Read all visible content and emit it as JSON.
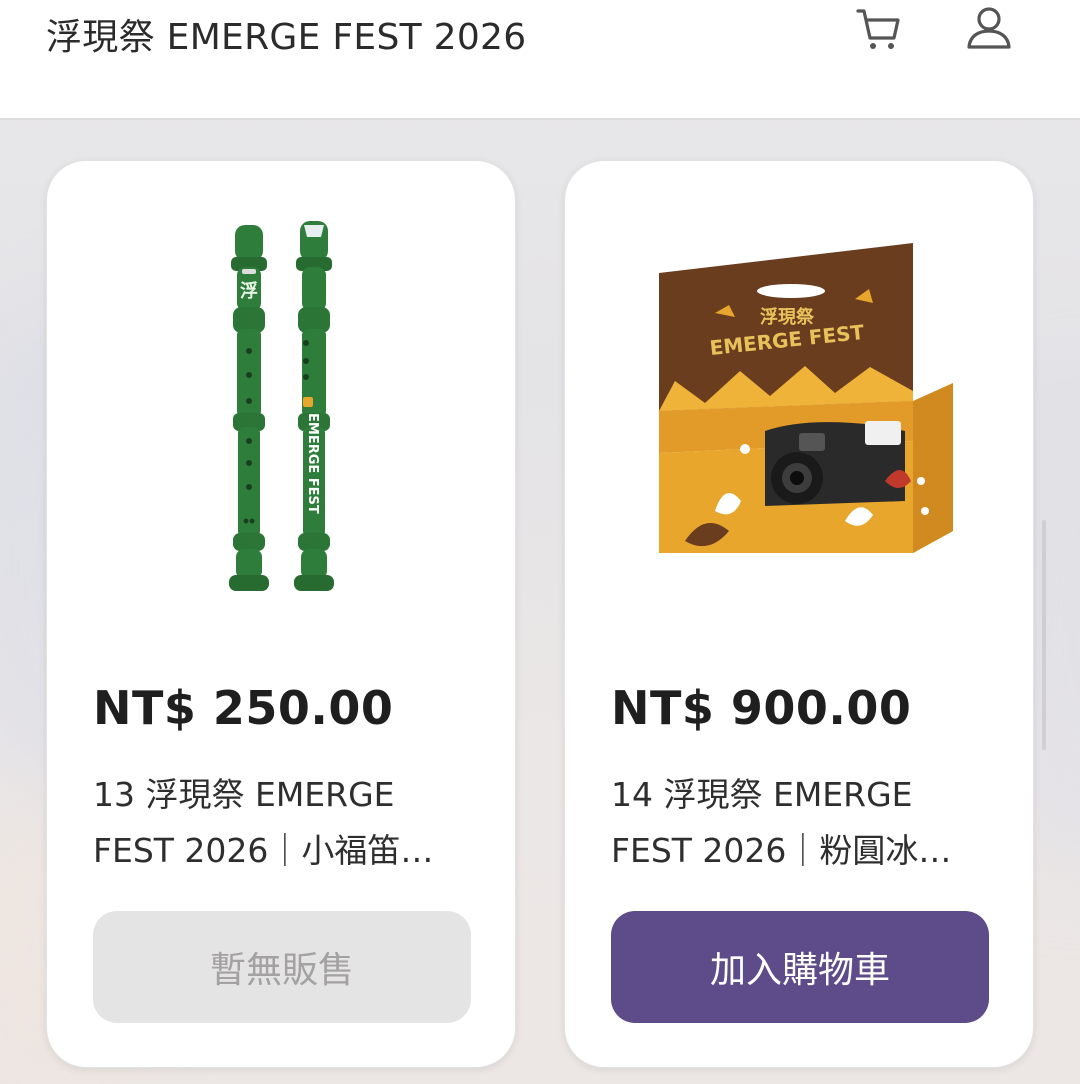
{
  "header": {
    "title": "浮現祭 EMERGE FEST 2026",
    "cart_icon": "cart-icon",
    "user_icon": "user-icon"
  },
  "products": [
    {
      "image_icon": "recorder-flute-image",
      "image_text_vertical": "EMERGE FEST",
      "image_text_char": "浮",
      "price": "NT$ 250.00",
      "title": "13 浮現祭 EMERGE FEST 2026｜小福笛…",
      "button_label": "暫無販售",
      "button_state": "disabled"
    },
    {
      "image_icon": "disposable-camera-image",
      "image_text_logo_top": "浮現祭",
      "image_text_logo_bottom": "EMERGE FEST",
      "price": "NT$ 900.00",
      "title": "14 浮現祭 EMERGE FEST 2026｜粉圓冰…",
      "button_label": "加入購物車",
      "button_state": "enabled"
    }
  ],
  "colors": {
    "primary_button": "#5d4b8a",
    "disabled_button": "#e5e4e4",
    "recorder_green": "#2e7d3a",
    "camera_orange": "#e8a62c",
    "camera_brown": "#6b3d1f"
  }
}
